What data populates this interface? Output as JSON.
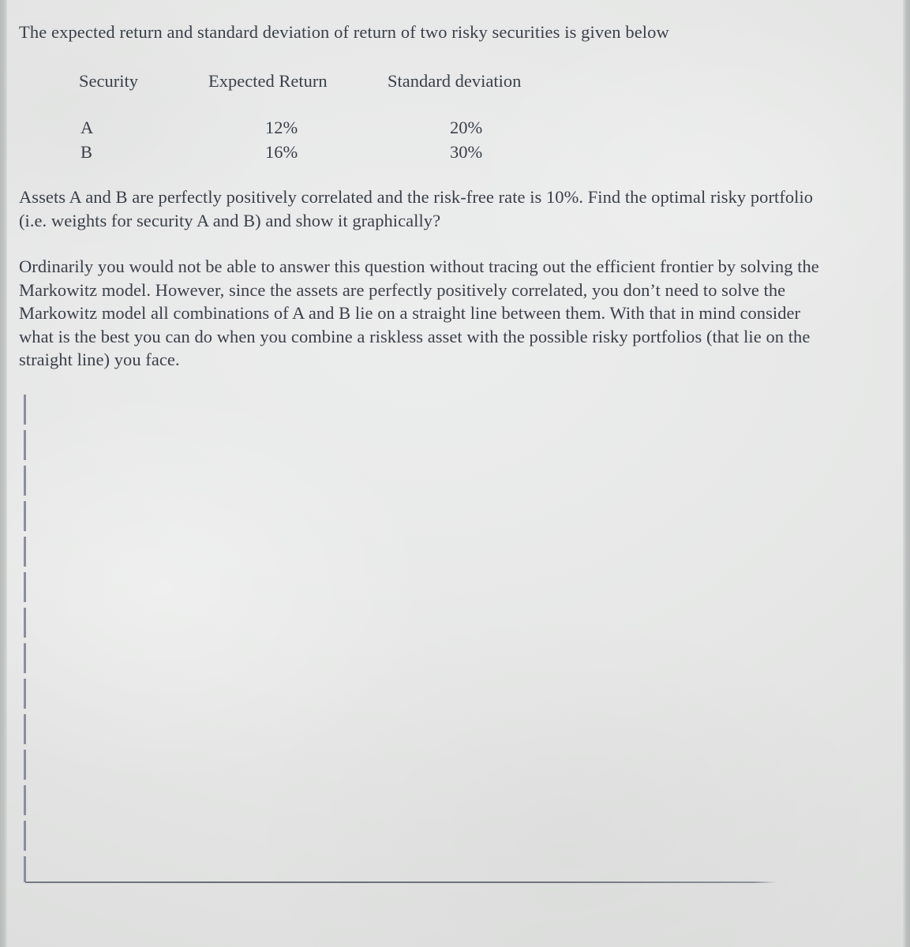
{
  "document": {
    "type": "scanned-worksheet-photo",
    "background_color": "#e4e5e3",
    "text_color": "#3a3f49",
    "rule_color": "#83869a",
    "baseline_rule_color": "#6b6e78"
  },
  "prompt": {
    "intro": "The expected return and standard deviation of return of two risky securities is given below"
  },
  "securities_table": {
    "columns": [
      "Security",
      "Expected Return",
      "Standard deviation"
    ],
    "rows": [
      {
        "security": "A",
        "expected_return": "12%",
        "standard_deviation": "20%"
      },
      {
        "security": "B",
        "expected_return": "16%",
        "standard_deviation": "30%"
      }
    ]
  },
  "question": {
    "text": "Assets A and B are perfectly positively correlated and the risk-free rate is 10%. Find the optimal risky portfolio (i.e. weights for security A and B) and show it graphically?"
  },
  "hint": {
    "text": "Ordinarily you would not be able to answer this question without tracing out the efficient frontier by solving the Markowitz model. However, since the assets are perfectly positively correlated, you don’t need to solve the Markowitz model all combinations of A and B lie on a straight line between them. With that in mind consider what is the best you can do when you combine a riskless asset with the possible risky portfolios (that lie on the straight line) you face."
  },
  "answer_area": {
    "vertical_rule_label": "dashed vertical margin rule",
    "horizontal_rule_label": "horizontal baseline rule"
  }
}
